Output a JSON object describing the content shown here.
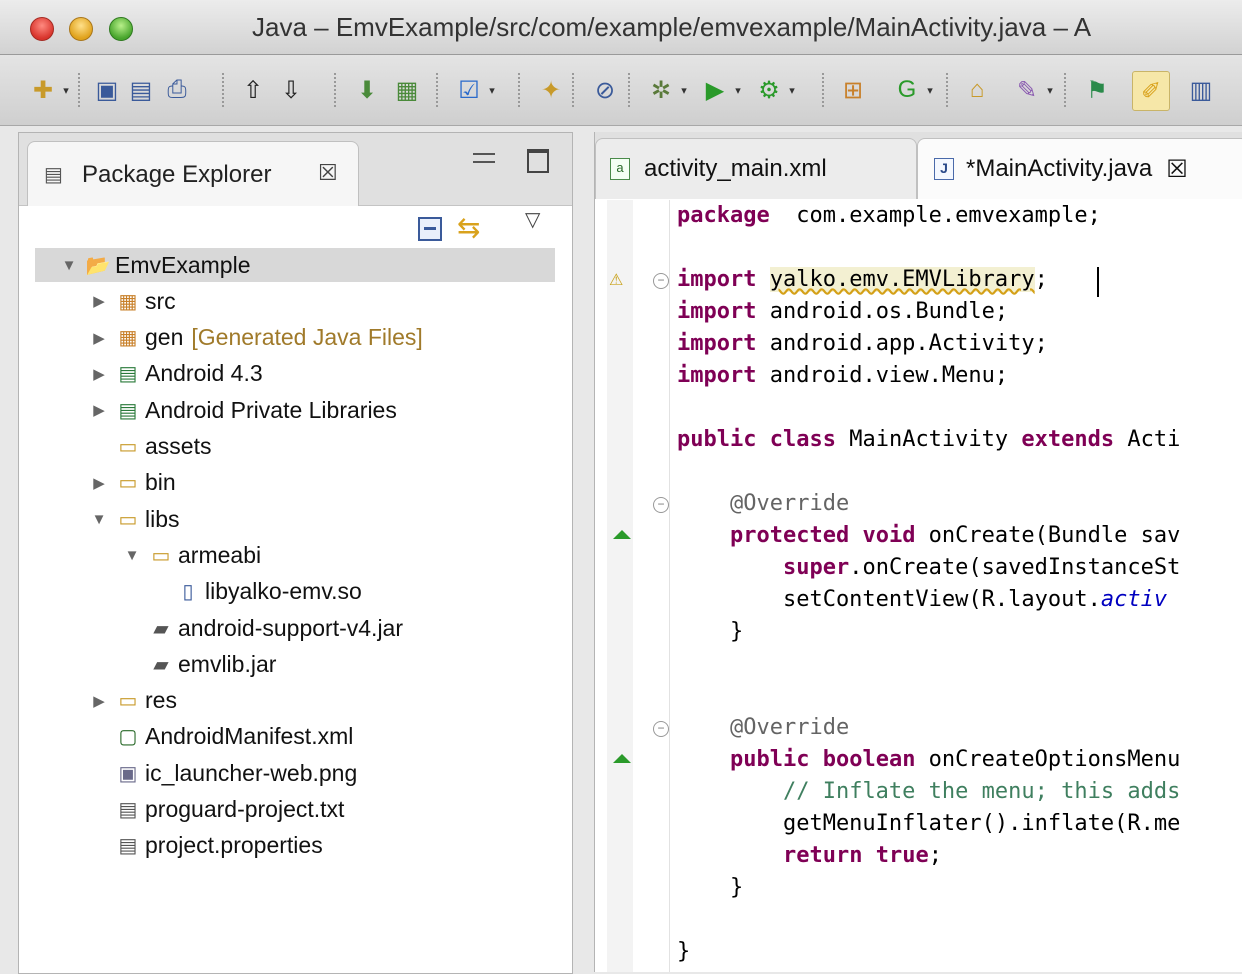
{
  "window": {
    "title": "Java – EmvExample/src/com/example/emvexample/MainActivity.java – A"
  },
  "toolbar": {
    "icons": [
      "new-icon",
      "save-icon",
      "save-all-icon",
      "print-icon",
      "upload-icon",
      "download-icon",
      "android-sdk-icon",
      "android-avd-icon",
      "checkbox-icon",
      "new-class-icon",
      "skip-breakpoints-icon",
      "debug-icon",
      "run-icon",
      "external-tools-icon",
      "new-package-icon",
      "new-type-icon",
      "open-type-icon",
      "search-icon",
      "annotation-icon",
      "highlight-icon",
      "outline-icon"
    ]
  },
  "package_explorer": {
    "title": "Package Explorer",
    "close_glyph": "☒",
    "tree": [
      {
        "label": "EmvExample",
        "decor": "",
        "twisty": "▼",
        "icon": "project-icon",
        "level": 0,
        "selected": true
      },
      {
        "label": "src",
        "decor": "",
        "twisty": "▶",
        "icon": "source-folder-icon",
        "level": 1
      },
      {
        "label": "gen",
        "decor": "[Generated Java Files]",
        "twisty": "▶",
        "icon": "generated-folder-icon",
        "level": 1
      },
      {
        "label": "Android 4.3",
        "decor": "",
        "twisty": "▶",
        "icon": "library-icon",
        "level": 1
      },
      {
        "label": "Android Private Libraries",
        "decor": "",
        "twisty": "▶",
        "icon": "library-icon",
        "level": 1
      },
      {
        "label": "assets",
        "decor": "",
        "twisty": "",
        "icon": "folder-icon",
        "level": 1
      },
      {
        "label": "bin",
        "decor": "",
        "twisty": "▶",
        "icon": "folder-icon",
        "level": 1
      },
      {
        "label": "libs",
        "decor": "",
        "twisty": "▼",
        "icon": "folder-icon",
        "level": 1
      },
      {
        "label": "armeabi",
        "decor": "",
        "twisty": "▼",
        "icon": "open-folder-icon",
        "level": 2
      },
      {
        "label": "libyalko-emv.so",
        "decor": "",
        "twisty": "",
        "icon": "binary-file-icon",
        "level": 3
      },
      {
        "label": "android-support-v4.jar",
        "decor": "",
        "twisty": "",
        "icon": "jar-icon",
        "level": 2
      },
      {
        "label": "emvlib.jar",
        "decor": "",
        "twisty": "",
        "icon": "jar-icon",
        "level": 2
      },
      {
        "label": "res",
        "decor": "",
        "twisty": "▶",
        "icon": "folder-icon",
        "level": 1
      },
      {
        "label": "AndroidManifest.xml",
        "decor": "",
        "twisty": "",
        "icon": "xml-file-icon",
        "level": 1
      },
      {
        "label": "ic_launcher-web.png",
        "decor": "",
        "twisty": "",
        "icon": "image-file-icon",
        "level": 1
      },
      {
        "label": "proguard-project.txt",
        "decor": "",
        "twisty": "",
        "icon": "text-file-icon",
        "level": 1
      },
      {
        "label": "project.properties",
        "decor": "",
        "twisty": "",
        "icon": "text-file-icon",
        "level": 1
      }
    ]
  },
  "editor": {
    "tabs": [
      {
        "label": "activity_main.xml",
        "icon": "xml-file-icon",
        "active": false
      },
      {
        "label": "*MainActivity.java",
        "icon": "java-file-icon",
        "active": true,
        "close_glyph": "☒"
      }
    ],
    "lines": [
      {
        "row": 0,
        "parts": [
          [
            "kw",
            "package"
          ],
          [
            "",
            "  com.example.emvexample;"
          ]
        ]
      },
      {
        "row": 2,
        "fold": "⊖",
        "warning": true,
        "parts": [
          [
            "kw",
            "import"
          ],
          [
            "",
            " "
          ],
          [
            "hl",
            "yalko.emv.EMVLibrary"
          ],
          [
            "",
            ";"
          ]
        ]
      },
      {
        "row": 3,
        "parts": [
          [
            "kw",
            "import"
          ],
          [
            "",
            " android.os.Bundle;"
          ]
        ]
      },
      {
        "row": 4,
        "parts": [
          [
            "kw",
            "import"
          ],
          [
            "",
            " android.app.Activity;"
          ]
        ]
      },
      {
        "row": 5,
        "parts": [
          [
            "kw",
            "import"
          ],
          [
            "",
            " android.view.Menu;"
          ]
        ]
      },
      {
        "row": 7,
        "parts": [
          [
            "kw",
            "public"
          ],
          [
            "",
            " "
          ],
          [
            "kw",
            "class"
          ],
          [
            "",
            " MainActivity "
          ],
          [
            "kw",
            "extends"
          ],
          [
            "",
            " Acti"
          ]
        ]
      },
      {
        "row": 9,
        "fold": "⊖",
        "parts": [
          [
            "",
            "    "
          ],
          [
            "ann",
            "@Override"
          ]
        ]
      },
      {
        "row": 10,
        "override": true,
        "parts": [
          [
            "",
            "    "
          ],
          [
            "kw",
            "protected"
          ],
          [
            "",
            " "
          ],
          [
            "kw",
            "void"
          ],
          [
            "",
            " onCreate(Bundle sav"
          ]
        ]
      },
      {
        "row": 11,
        "parts": [
          [
            "",
            "        "
          ],
          [
            "kw",
            "super"
          ],
          [
            "",
            ".onCreate(savedInstanceSt"
          ]
        ]
      },
      {
        "row": 12,
        "parts": [
          [
            "",
            "        setContentView(R.layout."
          ],
          [
            "it",
            "activ"
          ]
        ]
      },
      {
        "row": 13,
        "parts": [
          [
            "",
            "    }"
          ]
        ]
      },
      {
        "row": 16,
        "fold": "⊖",
        "parts": [
          [
            "",
            "    "
          ],
          [
            "ann",
            "@Override"
          ]
        ]
      },
      {
        "row": 17,
        "override": true,
        "parts": [
          [
            "",
            "    "
          ],
          [
            "kw",
            "public"
          ],
          [
            "",
            " "
          ],
          [
            "kw",
            "boolean"
          ],
          [
            "",
            " onCreateOptionsMenu"
          ]
        ]
      },
      {
        "row": 18,
        "parts": [
          [
            "",
            "        "
          ],
          [
            "cm",
            "// Inflate the menu; this adds"
          ]
        ]
      },
      {
        "row": 19,
        "parts": [
          [
            "",
            "        getMenuInflater().inflate(R.me"
          ]
        ]
      },
      {
        "row": 20,
        "parts": [
          [
            "",
            "        "
          ],
          [
            "kw",
            "return"
          ],
          [
            "",
            " "
          ],
          [
            "kw",
            "true"
          ],
          [
            "",
            ";"
          ]
        ]
      },
      {
        "row": 21,
        "parts": [
          [
            "",
            "    }"
          ]
        ]
      },
      {
        "row": 23,
        "parts": [
          [
            "",
            "}"
          ]
        ]
      }
    ]
  }
}
